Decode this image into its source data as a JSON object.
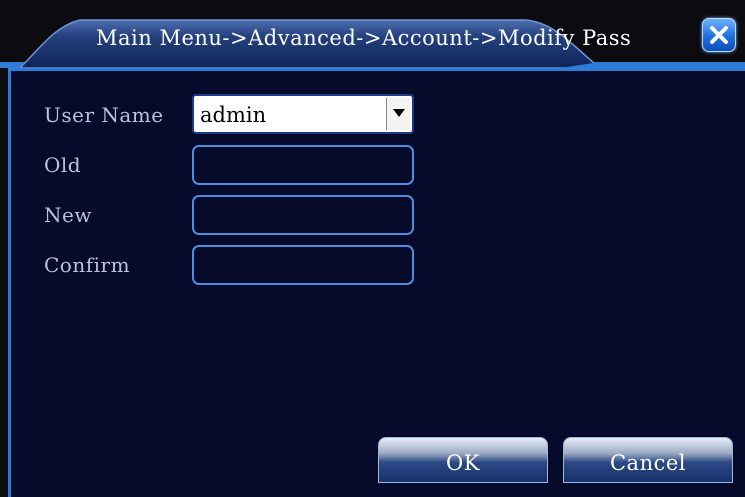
{
  "window": {
    "title": "Main Menu->Advanced->Account->Modify Pass"
  },
  "form": {
    "user_name_label": "User Name",
    "user_name_value": "admin",
    "old_label": "Old",
    "old_value": "",
    "new_label": "New",
    "new_value": "",
    "confirm_label": "Confirm",
    "confirm_value": ""
  },
  "buttons": {
    "ok_label": "OK",
    "cancel_label": "Cancel"
  },
  "icons": {
    "close": "close-icon",
    "dropdown": "chevron-down-icon"
  },
  "colors": {
    "background": "#050a2a",
    "accent": "#2f7bd8",
    "label": "#b9c4d8",
    "close_button": "#1f6fe0"
  }
}
